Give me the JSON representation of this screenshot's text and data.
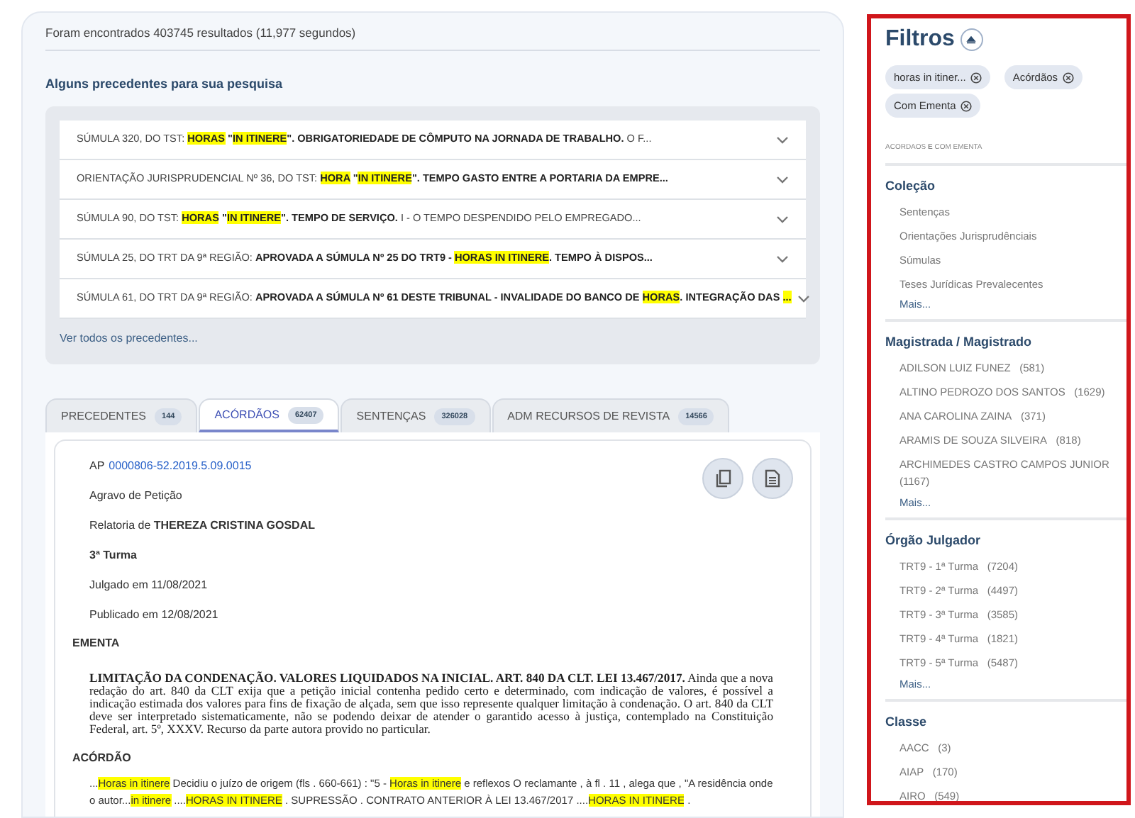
{
  "results_summary": "Foram encontrados 403745 resultados (11,977 segundos)",
  "precedents": {
    "heading": "Alguns precedentes para sua pesquisa",
    "items": [
      {
        "parts": [
          {
            "text": "SÚMULA 320, DO TST: ",
            "kind": "plain"
          },
          {
            "text": "HORAS",
            "kind": "highlight"
          },
          {
            "text": " \"",
            "kind": "bold"
          },
          {
            "text": "IN ITINERE",
            "kind": "highlight"
          },
          {
            "text": "\". OBRIGATORIEDADE DE CÔMPUTO NA JORNADA DE TRABALHO.",
            "kind": "bold"
          },
          {
            "text": " O F...",
            "kind": "plain"
          }
        ]
      },
      {
        "parts": [
          {
            "text": "ORIENTAÇÃO JURISPRUDENCIAL Nº 36, DO TST: ",
            "kind": "plain"
          },
          {
            "text": "HORA",
            "kind": "highlight"
          },
          {
            "text": " \"",
            "kind": "bold"
          },
          {
            "text": "IN ITINERE",
            "kind": "highlight"
          },
          {
            "text": "\". TEMPO GASTO ENTRE A PORTARIA DA EMPRE...",
            "kind": "bold"
          }
        ]
      },
      {
        "parts": [
          {
            "text": "SÚMULA 90, DO TST: ",
            "kind": "plain"
          },
          {
            "text": "HORAS",
            "kind": "highlight"
          },
          {
            "text": " \"",
            "kind": "bold"
          },
          {
            "text": "IN ITINERE",
            "kind": "highlight"
          },
          {
            "text": "\". TEMPO DE SERVIÇO.",
            "kind": "bold"
          },
          {
            "text": " I - O TEMPO DESPENDIDO PELO EMPREGADO...",
            "kind": "plain"
          }
        ]
      },
      {
        "parts": [
          {
            "text": "SÚMULA 25, DO TRT DA 9ª REGIÃO: ",
            "kind": "plain"
          },
          {
            "text": "APROVADA A SÚMULA Nº 25 DO TRT9 - ",
            "kind": "bold"
          },
          {
            "text": "HORAS IN ITINERE",
            "kind": "highlight"
          },
          {
            "text": ". TEMPO À DISPOS...",
            "kind": "bold"
          }
        ]
      },
      {
        "parts": [
          {
            "text": "SÚMULA 61, DO TRT DA 9ª REGIÃO: ",
            "kind": "plain"
          },
          {
            "text": "APROVADA A SÚMULA Nº 61 DESTE TRIBUNAL - INVALIDADE DO BANCO DE ",
            "kind": "bold"
          },
          {
            "text": "HORAS",
            "kind": "highlight"
          },
          {
            "text": ". INTEGRAÇÃO DAS ",
            "kind": "bold"
          },
          {
            "text": "...",
            "kind": "highlight"
          }
        ]
      }
    ],
    "see_all": "Ver todos os precedentes..."
  },
  "tabs": [
    {
      "label": "PRECEDENTES",
      "count": "144",
      "selected": false
    },
    {
      "label": "ACÓRDÃOS",
      "count": "62407",
      "selected": true
    },
    {
      "label": "SENTENÇAS",
      "count": "326028",
      "selected": false
    },
    {
      "label": "ADM RECURSOS DE REVISTA",
      "count": "14566",
      "selected": false
    }
  ],
  "document": {
    "case_prefix": "AP",
    "case_number": "0000806-52.2019.5.09.0015",
    "case_class": "Agravo de Petição",
    "rapporteur": "Relatoria de **THEREZA CRISTINA GOSDAL**",
    "panel": "3ª Turma",
    "judged": "Julgado em 11/08/2021",
    "published": "Publicado em 12/08/2021",
    "ementa_heading": "EMENTA",
    "ementa": "**LIMITAÇÃO DA CONDENAÇÃO. VALORES LIQUIDADOS NA INICIAL. ART. 840 DA CLT. LEI 13.467/2017.** Ainda que a nova redação do art. 840 da CLT exija que a petição inicial contenha pedido certo e determinado, com indicação de valores, é possível a indicação estimada dos valores para fins de fixação de alçada, sem que isso represente qualquer limitação à condenação. O art. 840 da CLT deve ser interpretado sistematicamente, não se podendo deixar de atender o garantido acesso à justiça, contemplado na Constituição Federal, art. 5º, XXXV. Recurso da parte autora provido no particular.",
    "acordao_heading": "ACÓRDÃO",
    "acordao_parts": [
      {
        "text": "...",
        "highlighted": false
      },
      {
        "text": "Horas in itinere",
        "highlighted": true
      },
      {
        "text": " Decidiu o juízo de origem (fls . 660-661) : \"5 - ",
        "highlighted": false
      },
      {
        "text": "Horas in itinere",
        "highlighted": true
      },
      {
        "text": " e reflexos O reclamante , à fl . 11 , alega que , \"A residência onde o autor...",
        "highlighted": false
      },
      {
        "text": "in itinere",
        "highlighted": true
      },
      {
        "text": " ....",
        "highlighted": false
      },
      {
        "text": "HORAS IN ITINERE",
        "highlighted": true
      },
      {
        "text": " . SUPRESSÃO . CONTRATO ANTERIOR À LEI 13.467/2017 ....",
        "highlighted": false
      },
      {
        "text": "HORAS IN ITINERE",
        "highlighted": true
      },
      {
        "text": " .",
        "highlighted": false
      }
    ]
  },
  "filters": {
    "title": "Filtros",
    "chips": [
      "horas in itiner...",
      "Acórdãos",
      "Com Ementa"
    ],
    "caption": "ACORDAOS **E** COM EMENTA",
    "sections": [
      {
        "title": "Coleção",
        "items": [
          {
            "label": "Sentenças"
          },
          {
            "label": "Orientações Jurisprudênciais"
          },
          {
            "label": "Súmulas"
          },
          {
            "label": "Teses Jurídicas Prevalecentes"
          }
        ],
        "more": "Mais..."
      },
      {
        "title": "Magistrada / Magistrado",
        "items": [
          {
            "label": "ADILSON LUIZ FUNEZ",
            "count": "(581)"
          },
          {
            "label": "ALTINO PEDROZO DOS SANTOS",
            "count": "(1629)"
          },
          {
            "label": "ANA CAROLINA ZAINA",
            "count": "(371)"
          },
          {
            "label": "ARAMIS DE SOUZA SILVEIRA",
            "count": "(818)"
          },
          {
            "label": "ARCHIMEDES CASTRO CAMPOS JUNIOR",
            "count": "(1167)"
          }
        ],
        "more": "Mais..."
      },
      {
        "title": "Órgão Julgador",
        "items": [
          {
            "label": "TRT9 - 1ª Turma",
            "count": "(7204)"
          },
          {
            "label": "TRT9 - 2ª Turma",
            "count": "(4497)"
          },
          {
            "label": "TRT9 - 3ª Turma",
            "count": "(3585)"
          },
          {
            "label": "TRT9 - 4ª Turma",
            "count": "(1821)"
          },
          {
            "label": "TRT9 - 5ª Turma",
            "count": "(5487)"
          }
        ],
        "more": "Mais..."
      },
      {
        "title": "Classe",
        "items": [
          {
            "label": "AACC",
            "count": "(3)"
          },
          {
            "label": "AIAP",
            "count": "(170)"
          },
          {
            "label": "AIRO",
            "count": "(549)"
          }
        ]
      }
    ]
  }
}
